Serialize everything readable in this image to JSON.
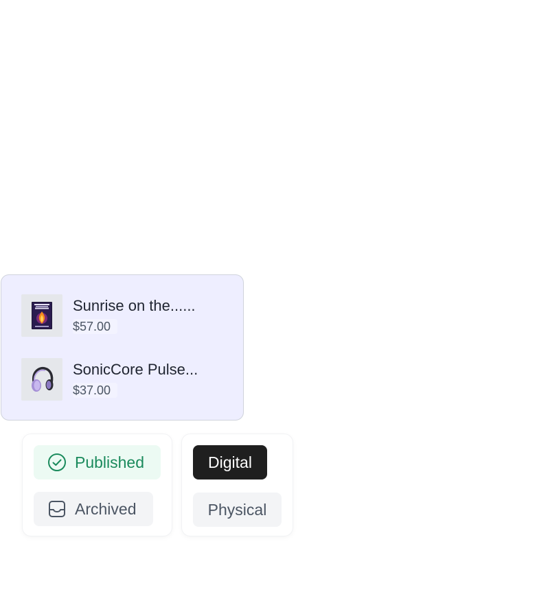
{
  "products": [
    {
      "title": "Sunrise on the......",
      "price": "$57.00",
      "thumbnail_icon": "book-cover-icon"
    },
    {
      "title": "SonicCore Pulse...",
      "price": "$37.00",
      "thumbnail_icon": "headphones-icon"
    }
  ],
  "status_filters": [
    {
      "label": "Published",
      "icon": "check-circle-icon",
      "selected": true
    },
    {
      "label": "Archived",
      "icon": "inbox-tray-icon",
      "selected": false
    }
  ],
  "type_filters": [
    {
      "label": "Digital",
      "selected": true
    },
    {
      "label": "Physical",
      "selected": false
    }
  ],
  "colors": {
    "card_background": "#eeeeff",
    "published_green": "#1a8a5c",
    "published_bg": "#ecfaf3",
    "selected_dark": "#1f1f1f"
  }
}
